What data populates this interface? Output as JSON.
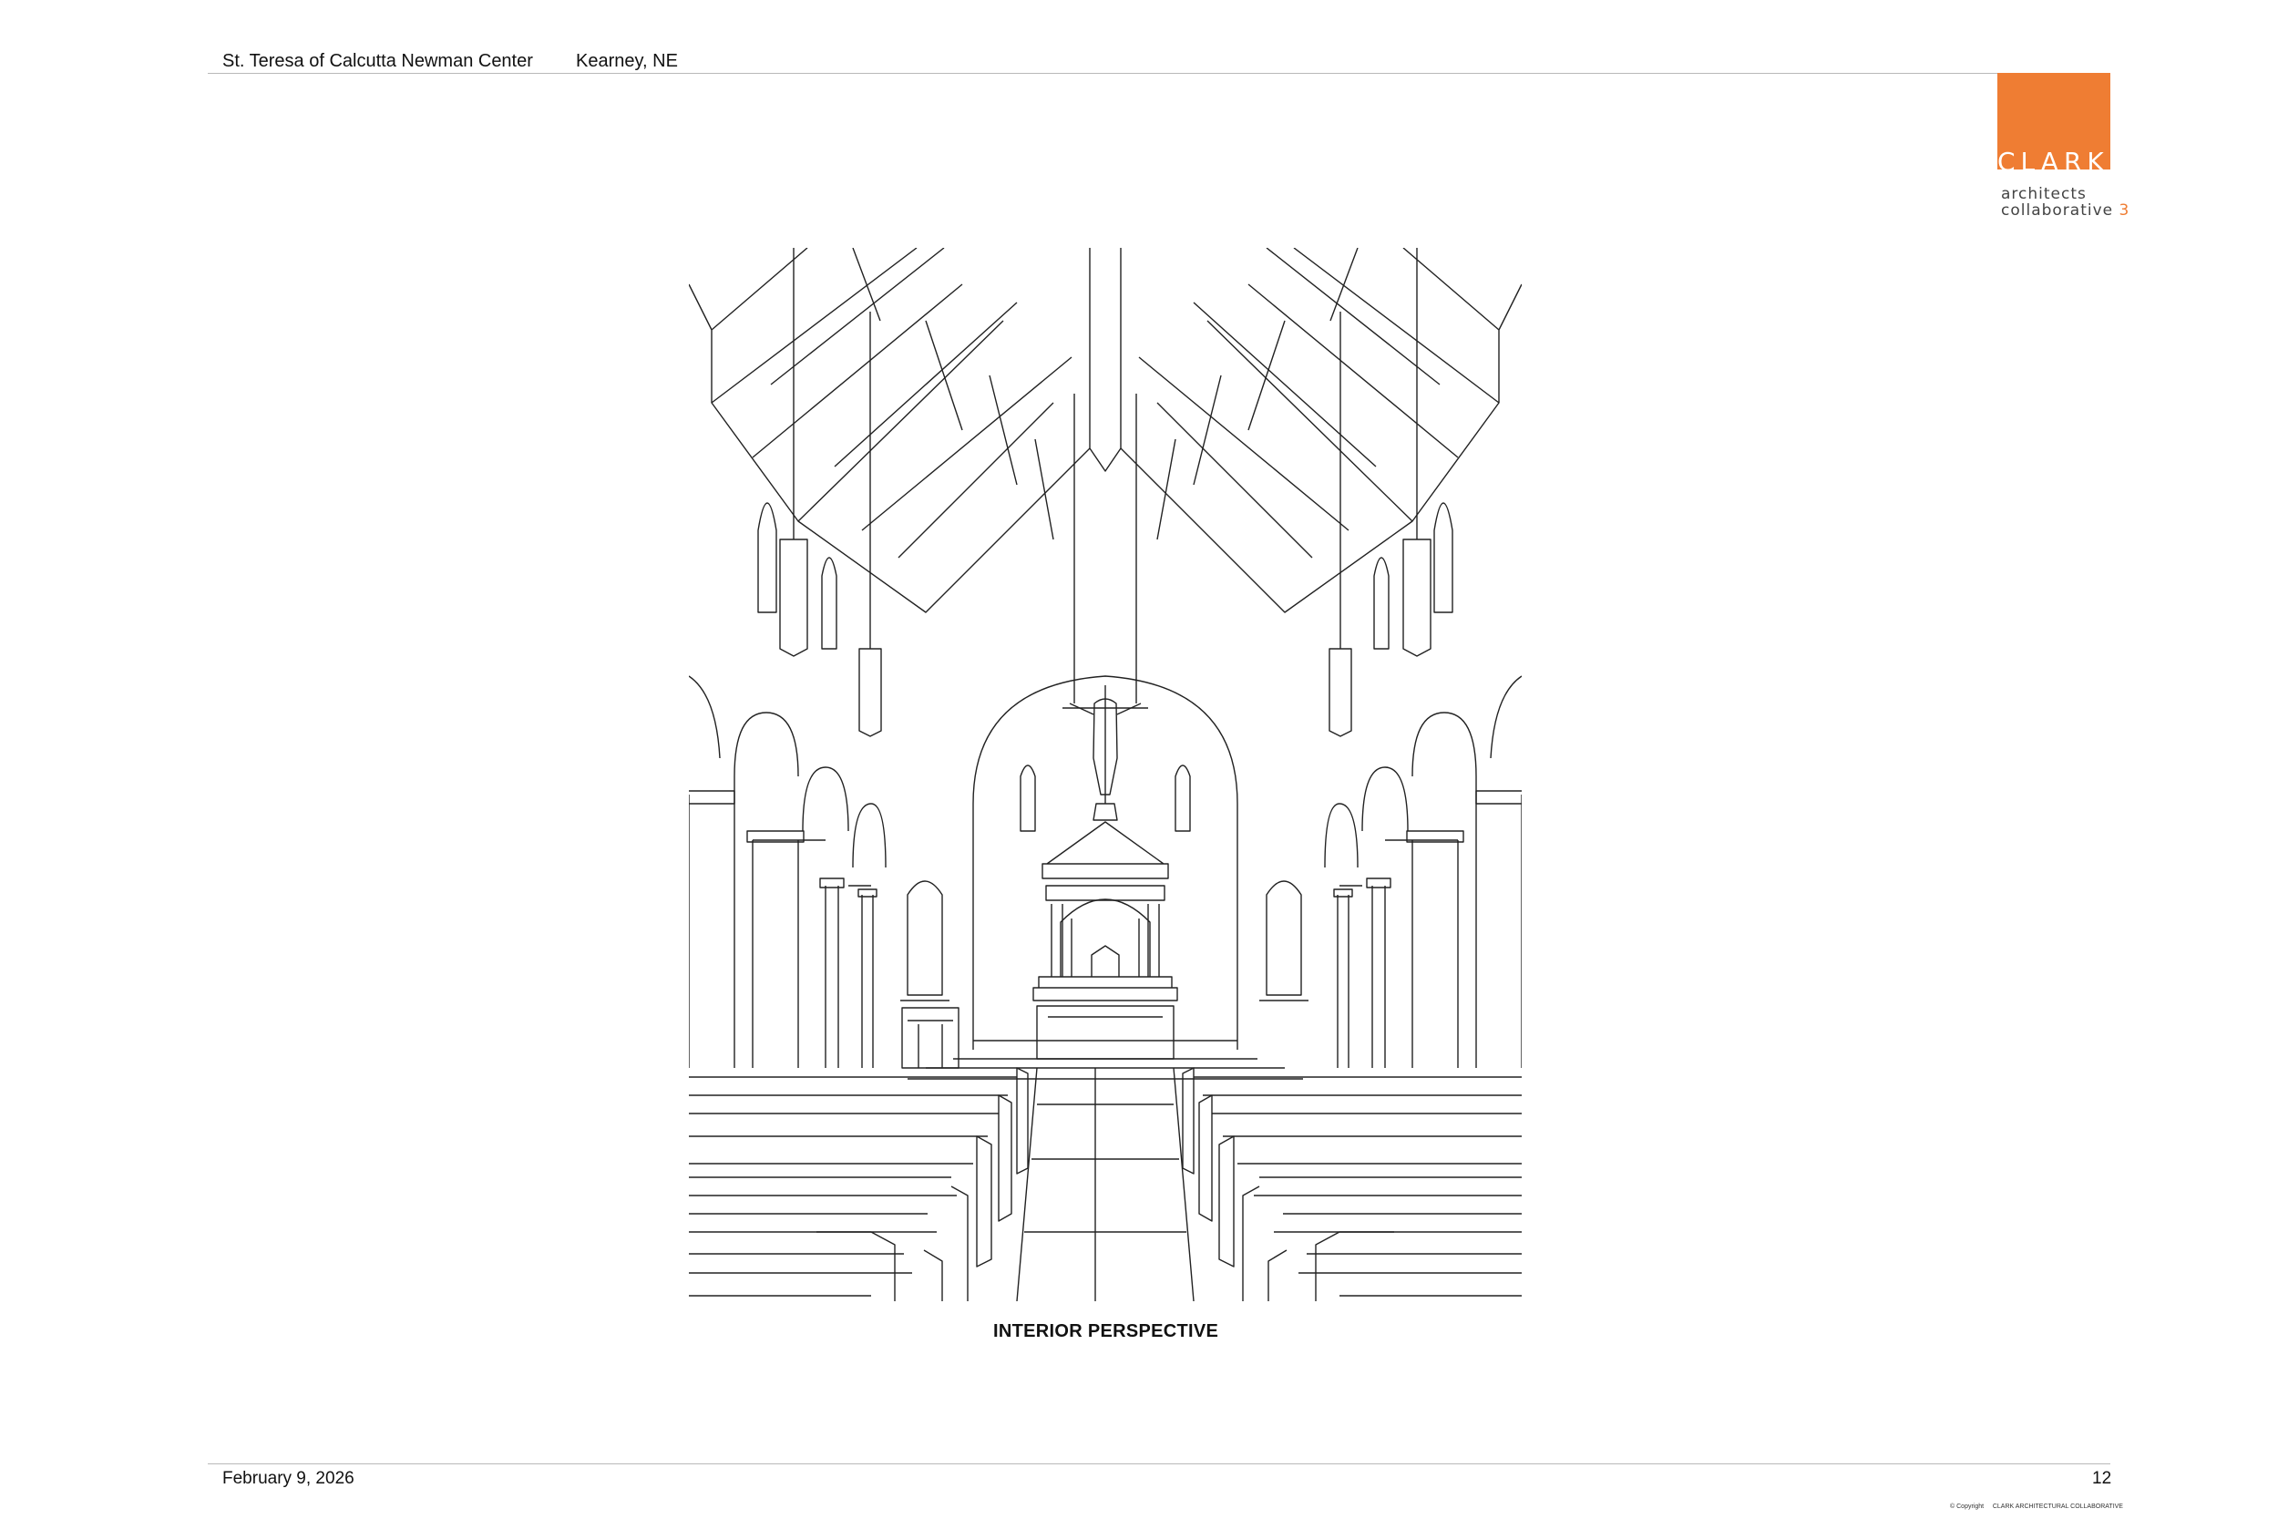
{
  "header": {
    "project": "St. Teresa of Calcutta Newman Center",
    "location": "Kearney, NE"
  },
  "logo": {
    "word": "CLARK",
    "line1": "architects",
    "line2": "collaborative",
    "number": "3",
    "accent_color": "#ef7d33"
  },
  "drawing": {
    "caption": "INTERIOR PERSPECTIVE",
    "line_color": "#222222"
  },
  "footer": {
    "date": "February 9, 2026",
    "page_number": "12",
    "copyright_symbol": "©",
    "copyright_label": "Copyright",
    "copyright_holder": "CLARK ARCHITECTURAL COLLABORATIVE"
  }
}
